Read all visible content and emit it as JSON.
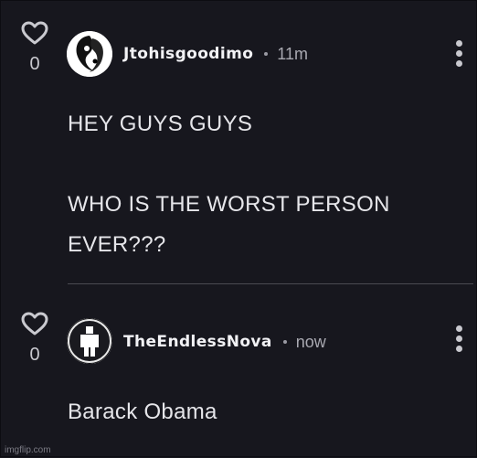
{
  "comments": [
    {
      "username": "Jtohisgoodimo",
      "time": "11m",
      "vote_count": "0",
      "lines": [
        "HEY GUYS GUYS",
        "",
        "WHO IS THE WORST PERSON",
        "EVER???"
      ]
    },
    {
      "username": "TheEndlessNova",
      "time": "now",
      "vote_count": "0",
      "lines": [
        "Barack Obama"
      ]
    }
  ],
  "watermark": "imgflip.com",
  "icons": {
    "vote": "heart-outline-icon",
    "more": "kebab-menu-icon",
    "avatar_1": "yin-yang-face-avatar",
    "avatar_2": "black-figure-avatar"
  },
  "colors": {
    "background": "#17171e",
    "text": "#e6e6ea",
    "muted": "#a9a9b1",
    "divider": "#4a4a52"
  }
}
